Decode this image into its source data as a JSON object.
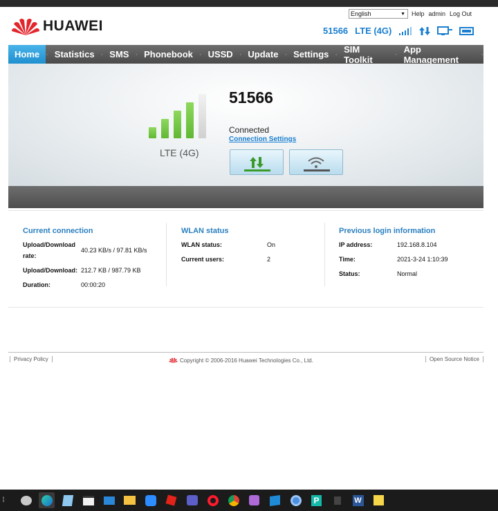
{
  "header": {
    "language": "English",
    "links": [
      "Help",
      "admin",
      "Log Out"
    ],
    "logo_text": "HUAWEI",
    "operator": "51566",
    "network": "LTE (4G)"
  },
  "nav": {
    "items": [
      "Home",
      "Statistics",
      "SMS",
      "Phonebook",
      "USSD",
      "Update",
      "Settings",
      "SIM Toolkit",
      "App Management"
    ],
    "active": "Home"
  },
  "hero": {
    "operator": "51566",
    "network_type": "LTE (4G)",
    "signal_strength_bars": 4,
    "signal_max_bars": 5,
    "status": "Connected",
    "connection_settings": "Connection Settings"
  },
  "current_connection": {
    "title": "Current connection",
    "rows": [
      {
        "label": "Upload/Download rate:",
        "value": "40.23 KB/s / 97.81 KB/s"
      },
      {
        "label": "Upload/Download:",
        "value": "212.7 KB / 987.79 KB"
      },
      {
        "label": "Duration:",
        "value": "00:00:20"
      }
    ]
  },
  "wlan_status": {
    "title": "WLAN status",
    "rows": [
      {
        "label": "WLAN status:",
        "value": "On"
      },
      {
        "label": "Current users:",
        "value": "2"
      }
    ]
  },
  "previous_login": {
    "title": "Previous login information",
    "rows": [
      {
        "label": "IP address:",
        "value": "192.168.8.104"
      },
      {
        "label": "Time:",
        "value": "2021-3-24 1:10:39"
      },
      {
        "label": "Status:",
        "value": "Normal"
      }
    ]
  },
  "footer": {
    "privacy": "Privacy Policy",
    "copyright": "Copyright © 2006-2016 Huawei Technologies Co., Ltd.",
    "open_source": "Open Source Notice"
  },
  "colors": {
    "accent": "#1a7fd0",
    "nav_bg": "#555555",
    "nav_active": "#2b9fdc",
    "signal_on": "#5fb832",
    "signal_off": "#d0d0d0",
    "brand_red": "#e3262c"
  },
  "taskbar_icons": [
    "search-icon",
    "copilot-icon",
    "edge-icon",
    "notepad-icon",
    "store-icon",
    "mail-icon",
    "explorer-icon",
    "zoom-icon",
    "roblox-icon",
    "teams-icon",
    "opera-icon",
    "chrome-icon",
    "snip-icon",
    "terminal-icon",
    "chrome-alt-icon",
    "p-icon",
    "app-icon",
    "word-icon",
    "sticky-notes-icon"
  ]
}
